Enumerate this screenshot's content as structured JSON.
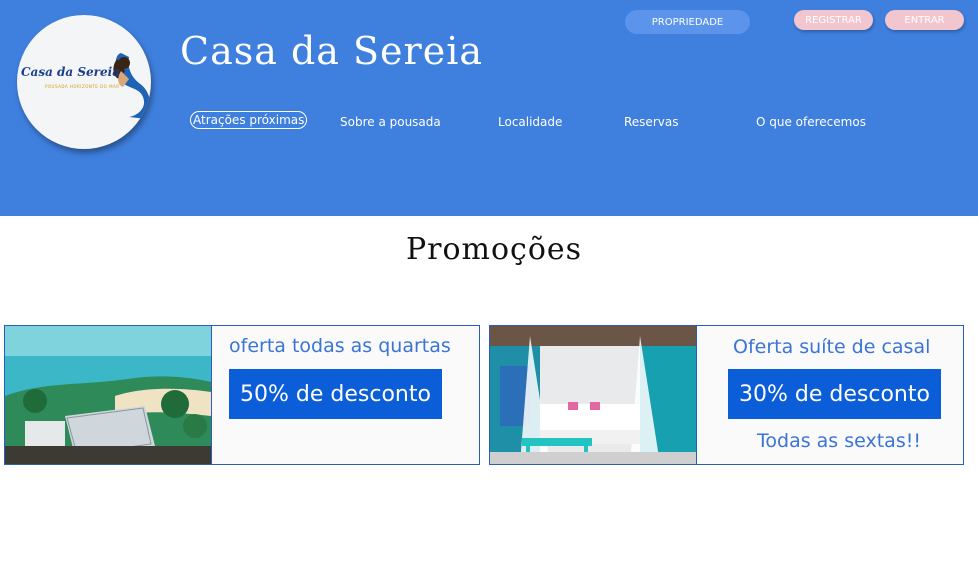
{
  "header": {
    "logo_text": "Casa da Sereia",
    "logo_subtext": "POUSADA HORIZONTE DO MAR",
    "site_title": "Casa da Sereia",
    "buttons": {
      "property": "PROPRIEDADE",
      "register": "REGISTRAR",
      "login": "ENTRAR"
    },
    "nav": [
      {
        "label": "Atrações próximas",
        "active": true
      },
      {
        "label": "Sobre a pousada"
      },
      {
        "label": "Localidade"
      },
      {
        "label": "Reservas"
      },
      {
        "label": "O que oferecemos"
      }
    ]
  },
  "promotions": {
    "title": "Promoções",
    "cards": [
      {
        "image": "beach-resort-photo",
        "offer": "oferta todas as quartas",
        "discount": "50% de desconto",
        "note": ""
      },
      {
        "image": "couple-suite-photo",
        "offer": "Oferta suíte de casal",
        "discount": "30% de desconto",
        "note": "Todas as sextas!!"
      }
    ]
  },
  "colors": {
    "header_bg": "#3f7fde",
    "accent_button": "#0b5ed7",
    "offer_text": "#3a74d6",
    "pill_pink": "#f2c6cf"
  }
}
